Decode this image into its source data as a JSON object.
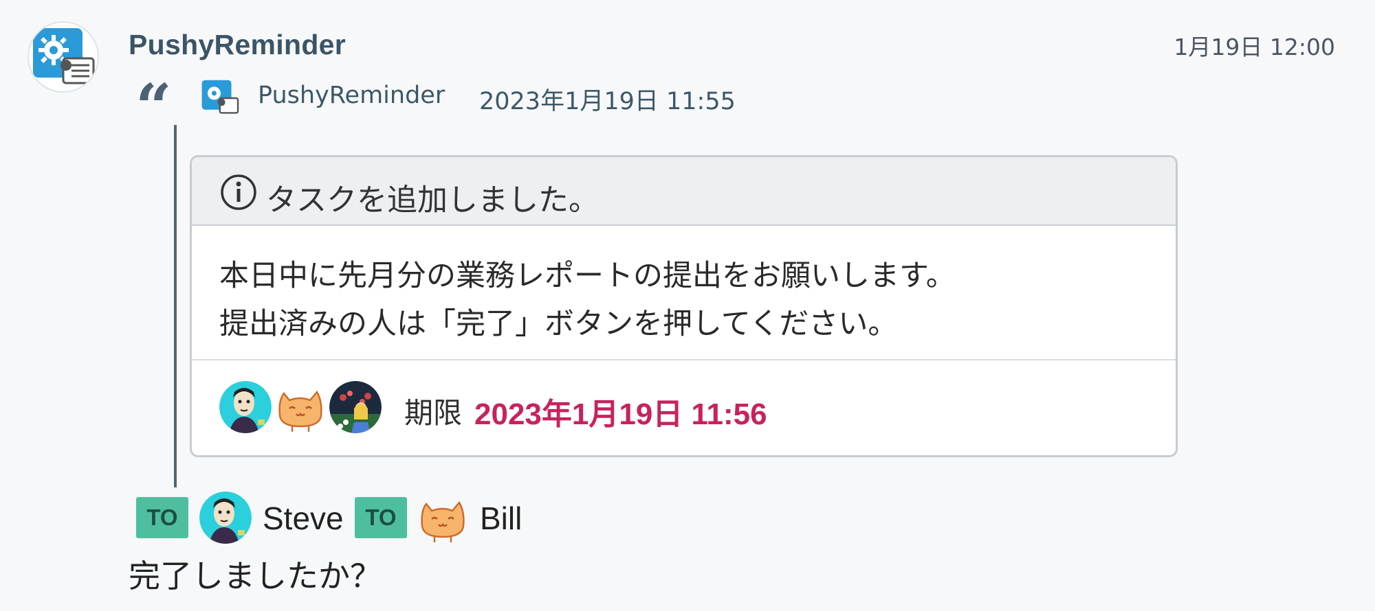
{
  "message": {
    "sender": "PushyReminder",
    "time": "1月19日 12:00",
    "quote": {
      "sender": "PushyReminder",
      "date": "2023年1月19日 11:55",
      "quote_icon": "left-quote-icon"
    },
    "task": {
      "header_icon": "info-icon",
      "title": "タスクを追加しました。",
      "body_lines": [
        "本日中に先月分の業務レポートの提出をお願いします。",
        "提出済みの人は「完了」ボタンを押してください。"
      ],
      "assignee_avatars": [
        "man-avatar",
        "cat-avatar",
        "girl-avatar"
      ],
      "deadline_label": "期限",
      "deadline_value": "2023年1月19日 11:56",
      "deadline_color": "#c8225c"
    },
    "to": [
      {
        "badge": "TO",
        "name": "Steve",
        "avatar": "man-avatar"
      },
      {
        "badge": "TO",
        "name": "Bill",
        "avatar": "cat-avatar"
      }
    ],
    "text": "完了しましたか？"
  },
  "colors": {
    "to_badge": "#4dbf9f",
    "sender_name": "#3b5566",
    "app_icon": "#2a9ad8"
  }
}
